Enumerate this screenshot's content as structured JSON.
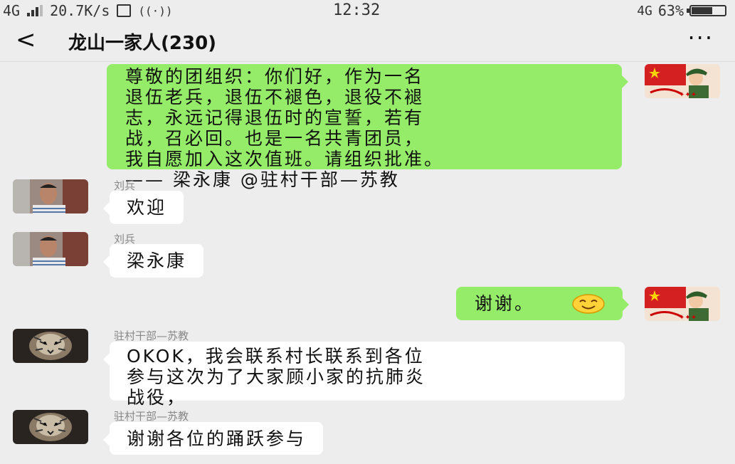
{
  "status_bar": {
    "network": "4G",
    "speed": "20.7K/s",
    "time": "12:32",
    "net_right": "4G",
    "battery": "63%",
    "battery_level": 0.63
  },
  "header": {
    "back_icon": "chevron-left-icon",
    "title": "龙山一家人(230)",
    "more_icon": "more-icon"
  },
  "messages": [
    {
      "direction": "outgoing",
      "lines": [
        "尊敬的团组织：你们好，作为一名",
        "退伍老兵，退伍不褪色，退役不褪",
        "志，永远记得退伍时的宣誓，若有",
        "战，召必回。也是一名共青团员，",
        "我自愿加入这次值班。请组织批准。",
        "—— 梁永康   @驻村干部—苏教"
      ]
    },
    {
      "direction": "incoming",
      "sender": "刘兵",
      "text": "欢迎"
    },
    {
      "direction": "incoming",
      "sender": "刘兵",
      "text": "梁永康"
    },
    {
      "direction": "outgoing",
      "text": "谢谢。",
      "emoji": "smile-emoji"
    },
    {
      "direction": "incoming",
      "sender": "驻村干部—苏教",
      "lines": [
        "OKOK，我会联系村长联系到各位",
        "参与这次为了大家顾小家的抗肺炎",
        "战役，"
      ]
    },
    {
      "direction": "incoming",
      "sender": "驻村干部—苏教",
      "text": "谢谢各位的踊跃参与"
    }
  ],
  "colors": {
    "background": "#ededed",
    "outgoing_bubble": "#95ec69",
    "incoming_bubble": "#ffffff",
    "sender": "#888888"
  }
}
